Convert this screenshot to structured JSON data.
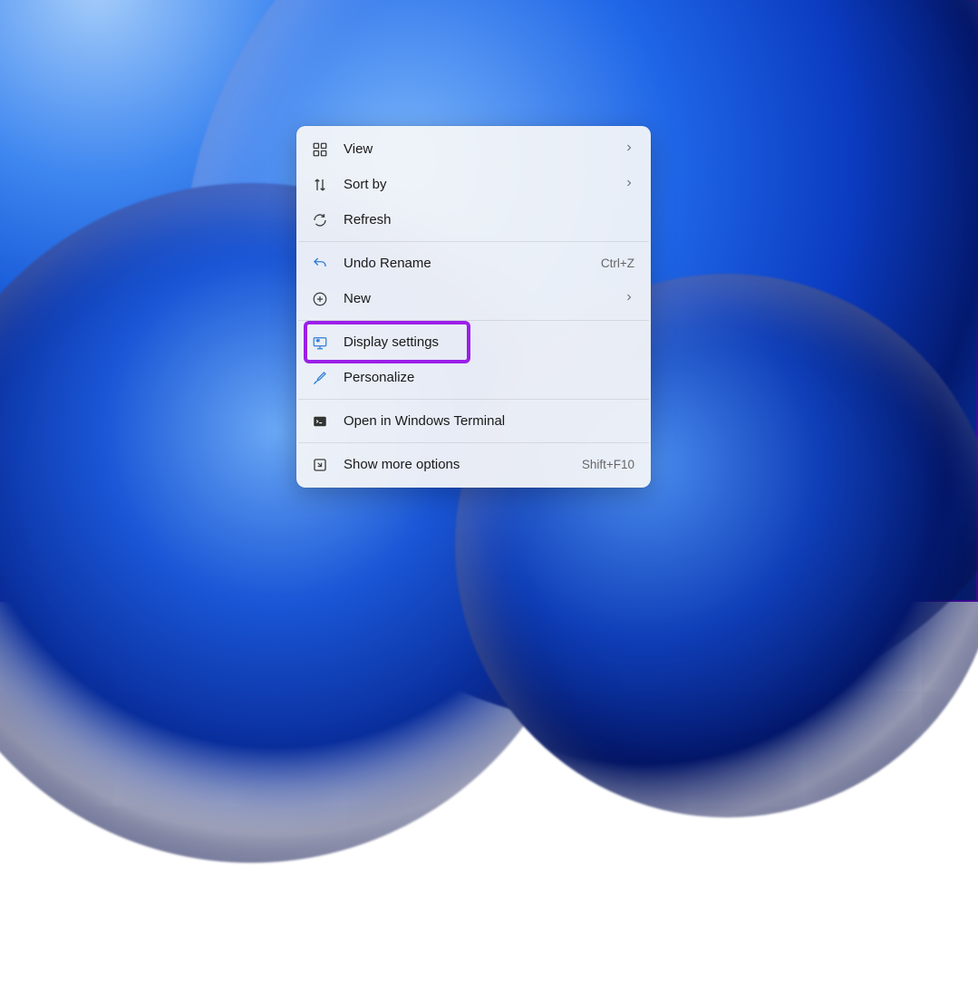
{
  "contextMenu": {
    "groups": [
      [
        {
          "id": "view",
          "label": "View",
          "icon": "grid-icon",
          "hasSubmenu": true
        },
        {
          "id": "sort",
          "label": "Sort by",
          "icon": "sort-icon",
          "hasSubmenu": true
        },
        {
          "id": "refresh",
          "label": "Refresh",
          "icon": "refresh-icon"
        }
      ],
      [
        {
          "id": "undo",
          "label": "Undo Rename",
          "icon": "undo-icon",
          "shortcut": "Ctrl+Z"
        },
        {
          "id": "new",
          "label": "New",
          "icon": "plus-icon",
          "hasSubmenu": true
        }
      ],
      [
        {
          "id": "display",
          "label": "Display settings",
          "icon": "display-icon",
          "highlighted": true
        },
        {
          "id": "personalize",
          "label": "Personalize",
          "icon": "brush-icon"
        }
      ],
      [
        {
          "id": "terminal",
          "label": "Open in Windows Terminal",
          "icon": "terminal-icon"
        }
      ],
      [
        {
          "id": "more",
          "label": "Show more options",
          "icon": "expand-icon",
          "shortcut": "Shift+F10"
        }
      ]
    ]
  }
}
